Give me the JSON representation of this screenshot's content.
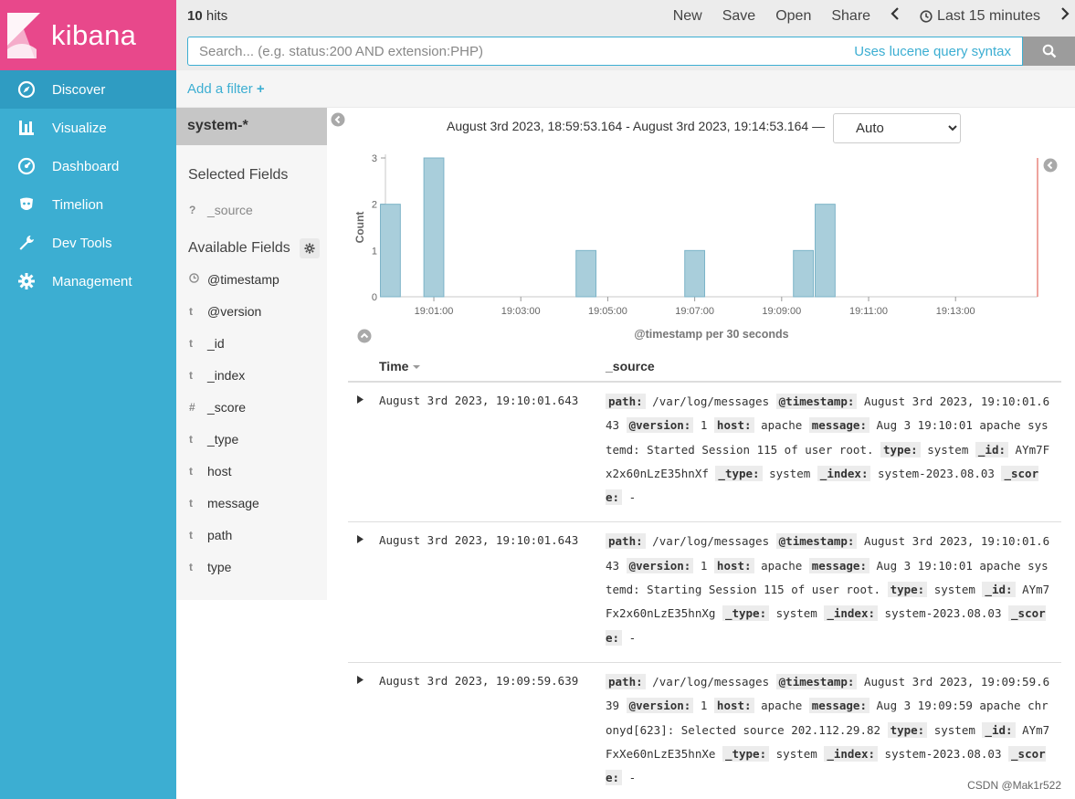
{
  "brand": {
    "name": "kibana"
  },
  "nav": [
    {
      "label": "Discover",
      "icon": "compass-icon",
      "active": true
    },
    {
      "label": "Visualize",
      "icon": "bar-chart-icon"
    },
    {
      "label": "Dashboard",
      "icon": "dashboard-icon"
    },
    {
      "label": "Timelion",
      "icon": "timelion-icon"
    },
    {
      "label": "Dev Tools",
      "icon": "wrench-icon"
    },
    {
      "label": "Management",
      "icon": "gear-icon"
    }
  ],
  "topbar": {
    "hits_count": "10",
    "hits_label": "hits",
    "new": "New",
    "save": "Save",
    "open": "Open",
    "share": "Share",
    "time_range": "Last 15 minutes"
  },
  "search": {
    "placeholder": "Search... (e.g. status:200 AND extension:PHP)",
    "hint": "Uses lucene query syntax"
  },
  "filter": {
    "add_label": "Add a filter",
    "plus": "+"
  },
  "fields_panel": {
    "index_pattern": "system-*",
    "selected_title": "Selected Fields",
    "selected_fields": [
      {
        "type": "?",
        "name": "_source"
      }
    ],
    "available_title": "Available Fields",
    "available_fields": [
      {
        "type": "clock",
        "name": "@timestamp"
      },
      {
        "type": "t",
        "name": "@version"
      },
      {
        "type": "t",
        "name": "_id"
      },
      {
        "type": "t",
        "name": "_index"
      },
      {
        "type": "#",
        "name": "_score"
      },
      {
        "type": "t",
        "name": "_type"
      },
      {
        "type": "t",
        "name": "host"
      },
      {
        "type": "t",
        "name": "message"
      },
      {
        "type": "t",
        "name": "path"
      },
      {
        "type": "t",
        "name": "type"
      }
    ]
  },
  "time_header": {
    "range": "August 3rd 2023, 18:59:53.164 - August 3rd 2023, 19:14:53.164 —",
    "interval": "Auto",
    "interval_options": [
      "Auto"
    ]
  },
  "chart_data": {
    "type": "bar",
    "ylabel": "Count",
    "xlabel": "@timestamp per 30 seconds",
    "ylim": [
      0,
      3
    ],
    "yticks": [
      0,
      1,
      2,
      3
    ],
    "xticks": [
      "19:01:00",
      "19:03:00",
      "19:05:00",
      "19:07:00",
      "19:09:00",
      "19:11:00",
      "19:13:00"
    ],
    "x": [
      "19:00:00",
      "19:01:00",
      "19:04:30",
      "19:07:00",
      "19:09:30",
      "19:10:00"
    ],
    "values": [
      2,
      3,
      1,
      1,
      1,
      2
    ],
    "range_start": "18:59:53.164",
    "range_end": "19:14:53.164",
    "bar_color": "#a9cedb",
    "bar_stroke": "#7cb3c7",
    "end_marker_color": "#e8857f",
    "grid": false
  },
  "table": {
    "col_time": "Time",
    "col_source": "_source",
    "sort_icon": "sort-down-icon",
    "rows": [
      {
        "time": "August 3rd 2023, 19:10:01.643",
        "fields": [
          {
            "k": "path:",
            "v": "/var/log/messages"
          },
          {
            "k": "@timestamp:",
            "v": "August 3rd 2023, 19:10:01.643"
          },
          {
            "k": "@version:",
            "v": "1"
          },
          {
            "k": "host:",
            "v": "apache"
          },
          {
            "k": "message:",
            "v": "Aug 3 19:10:01 apache systemd: Started Session 115 of user root."
          },
          {
            "k": "type:",
            "v": "system"
          },
          {
            "k": "_id:",
            "v": "AYm7Fx2x60nLzE35hnXf"
          },
          {
            "k": "_type:",
            "v": "system"
          },
          {
            "k": "_index:",
            "v": "system-2023.08.03"
          },
          {
            "k": "_score:",
            "v": "-"
          }
        ]
      },
      {
        "time": "August 3rd 2023, 19:10:01.643",
        "fields": [
          {
            "k": "path:",
            "v": "/var/log/messages"
          },
          {
            "k": "@timestamp:",
            "v": "August 3rd 2023, 19:10:01.643"
          },
          {
            "k": "@version:",
            "v": "1"
          },
          {
            "k": "host:",
            "v": "apache"
          },
          {
            "k": "message:",
            "v": "Aug 3 19:10:01 apache systemd: Starting Session 115 of user root."
          },
          {
            "k": "type:",
            "v": "system"
          },
          {
            "k": "_id:",
            "v": "AYm7Fx2x60nLzE35hnXg"
          },
          {
            "k": "_type:",
            "v": "system"
          },
          {
            "k": "_index:",
            "v": "system-2023.08.03"
          },
          {
            "k": "_score:",
            "v": "-"
          }
        ]
      },
      {
        "time": "August 3rd 2023, 19:09:59.639",
        "fields": [
          {
            "k": "path:",
            "v": "/var/log/messages"
          },
          {
            "k": "@timestamp:",
            "v": "August 3rd 2023, 19:09:59.639"
          },
          {
            "k": "@version:",
            "v": "1"
          },
          {
            "k": "host:",
            "v": "apache"
          },
          {
            "k": "message:",
            "v": "Aug 3 19:09:59 apache chronyd[623]: Selected source 202.112.29.82"
          },
          {
            "k": "type:",
            "v": "system"
          },
          {
            "k": "_id:",
            "v": "AYm7FxXe60nLzE35hnXe"
          },
          {
            "k": "_type:",
            "v": "system"
          },
          {
            "k": "_index:",
            "v": "system-2023.08.03"
          },
          {
            "k": "_score:",
            "v": "-"
          }
        ]
      }
    ]
  },
  "watermark": "CSDN @Mak1r522",
  "colors": {
    "sidebar": "#3caed2",
    "sidebar_active": "#2f9cc2",
    "brand": "#e8488b",
    "accent": "#3caed2"
  }
}
